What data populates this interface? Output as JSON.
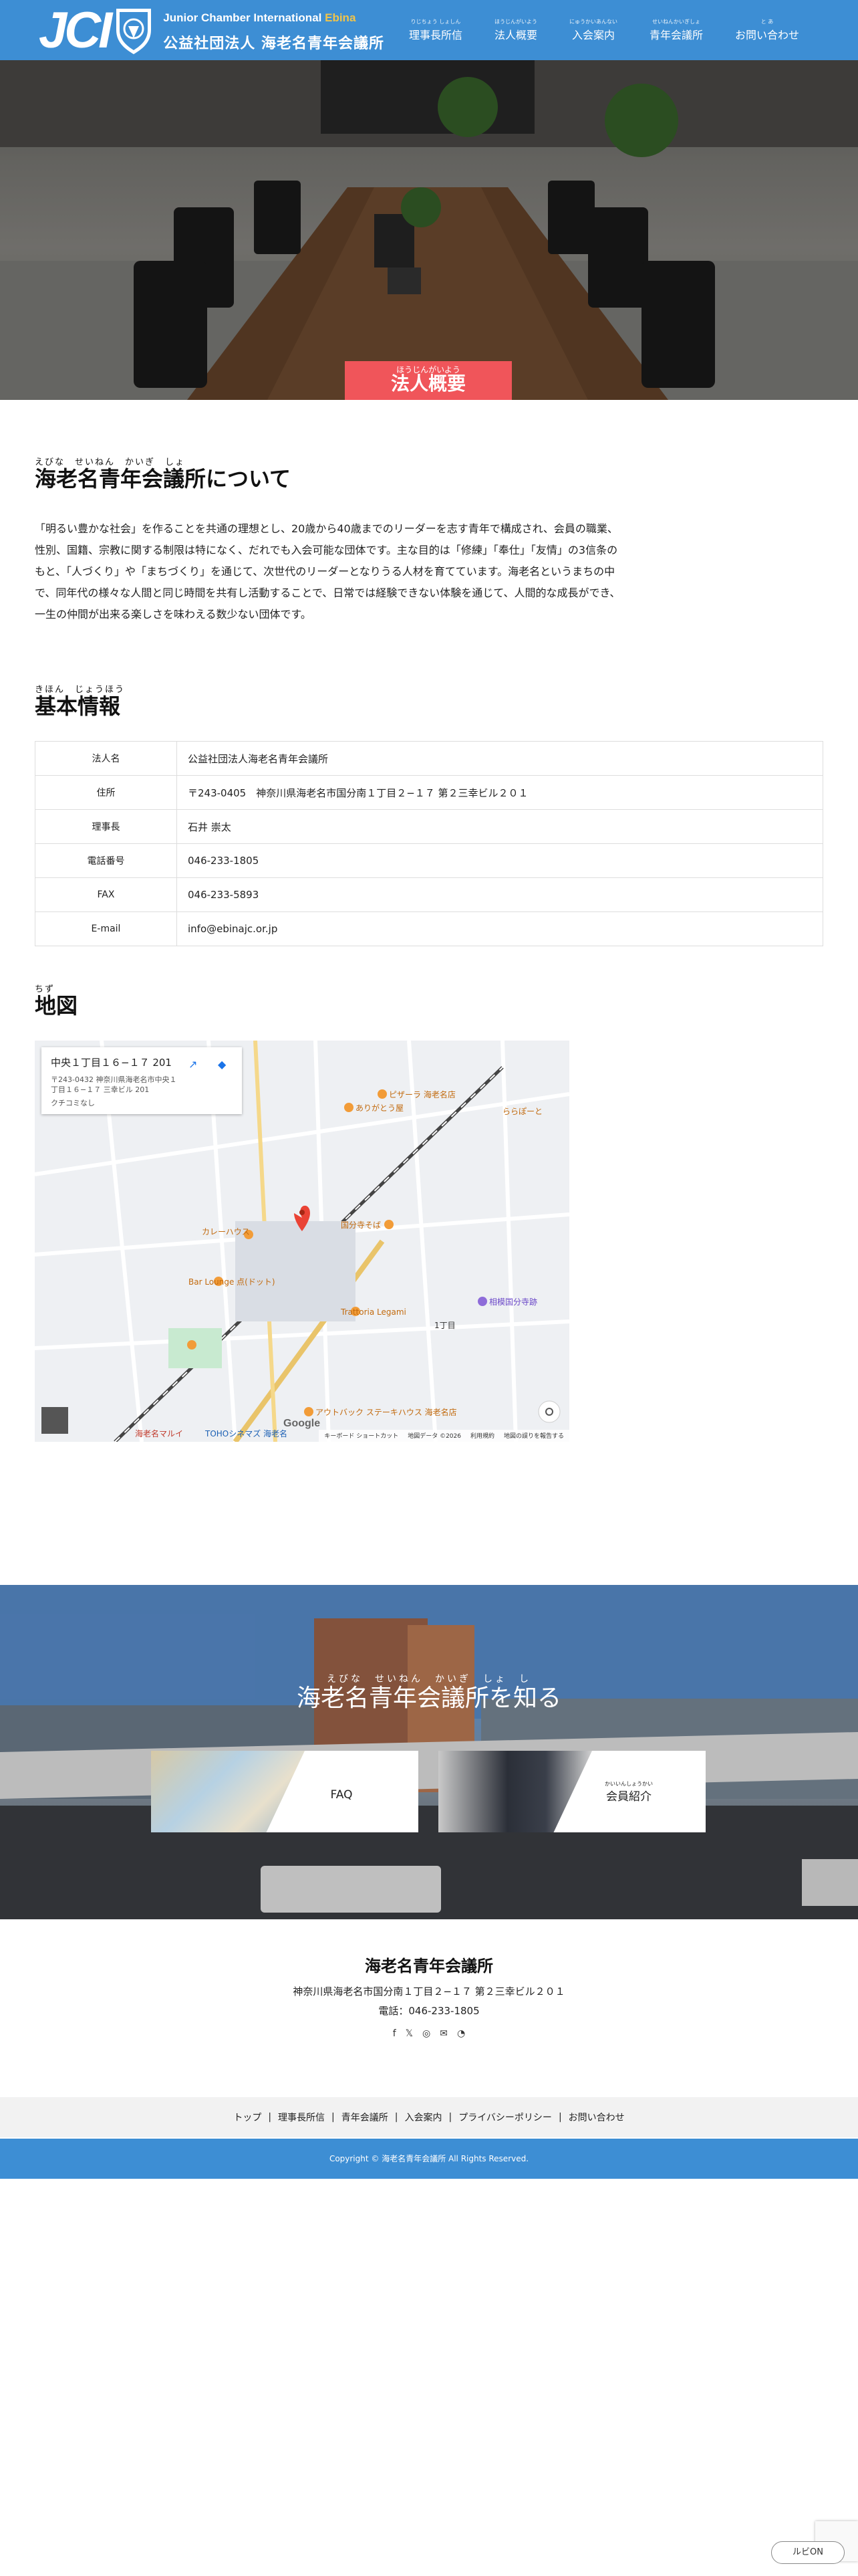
{
  "header": {
    "logo_text": "JCI",
    "org_en_a": "Junior Chamber International",
    "org_en_b": "Ebina",
    "org_jp": "公益社団法人 海老名青年会議所",
    "nav": [
      {
        "ruby": "りじちょう しょしん",
        "label": "理事長所信"
      },
      {
        "ruby": "ほうじんがいよう",
        "label": "法人概要"
      },
      {
        "ruby": "にゅうかいあんない",
        "label": "入会案内"
      },
      {
        "ruby": "せいねんかいぎしょ",
        "label": "青年会議所"
      },
      {
        "ruby": "と あ",
        "label": "お問い合わせ"
      }
    ]
  },
  "hero": {
    "ruby": "ほうじんがいよう",
    "title": "法人概要"
  },
  "about": {
    "heading_ruby": "えびな　せいねん　かいぎ　しょ",
    "heading": "海老名青年会議所について",
    "body": "「明るい豊かな社会」を作ることを共通の理想とし、20歳から40歳までのリーダーを志す青年で構成され、会員の職業、性別、国籍、宗教に関する制限は特になく、だれでも入会可能な団体です。主な目的は「修練」「奉仕」「友情」の3信条のもと、「人づくり」や「まちづくり」を通じて、次世代のリーダーとなりうる人材を育てています。海老名というまちの中で、同年代の様々な人間と同じ時間を共有し活動することで、日常では経験できない体験を通じて、人間的な成長ができ、一生の仲間が出来る楽しさを味わえる数少ない団体です。"
  },
  "basic": {
    "heading_ruby": "きほん　じょうほう",
    "heading": "基本情報",
    "rows": [
      {
        "key": "法人名",
        "value": "公益社団法人海老名青年会議所"
      },
      {
        "key": "住所",
        "value": "〒243-0405　神奈川県海老名市国分南１丁目２−１７ 第２三幸ビル２０１"
      },
      {
        "key": "理事長",
        "value": "石井 崇太"
      },
      {
        "key": "電話番号",
        "value": "046-233-1805"
      },
      {
        "key": "FAX",
        "value": "046-233-5893"
      },
      {
        "key": "E-mail",
        "value": "info@ebinajc.or.jp"
      }
    ]
  },
  "map_section": {
    "heading_ruby": "ちず",
    "heading": "地図",
    "card_title": "中央１丁目１６−１７ 201",
    "card_addr": "〒243-0432 神奈川県海老名市中央１丁目１６−１７ 三幸ビル 201",
    "card_link": "クチコミなし",
    "places": [
      "ありがとう屋",
      "ピザーラ 海老名店",
      "国分寺そば",
      "Bar Lounge 点(ドット)",
      "Trattoria Legami",
      "相模国分寺跡",
      "カレーハウス",
      "アウトバック ステーキハウス 海老名店",
      "ららぽーと",
      "TOHOシネマズ 海老名",
      "海老名マルイ",
      "1丁目"
    ],
    "footer": [
      "キーボード ショートカット",
      "地図データ ©2026",
      "利用規約",
      "地図の誤りを報告する"
    ],
    "google": "Google"
  },
  "know": {
    "heading_ruby": "えびな　せいねん　かいぎ　しょ　し",
    "heading": "海老名青年会議所を知る",
    "cards": [
      {
        "ruby": "",
        "label": "FAQ"
      },
      {
        "ruby": "かいいんしょうかい",
        "label": "会員紹介"
      }
    ]
  },
  "footer": {
    "name": "海老名青年会議所",
    "address": "神奈川県海老名市国分南１丁目２−１７ 第２三幸ビル２０１",
    "tel": "電話：046-233-1805",
    "nav": [
      "トップ",
      "理事長所信",
      "青年会議所",
      "入会案内",
      "プライバシーポリシー",
      "お問い合わせ"
    ],
    "copyright": "Copyright © 海老名青年会議所 All Rights Reserved."
  },
  "ruby_button": "ルビON",
  "colors": {
    "header": "#3d8ed4",
    "accent": "#f0555a",
    "logo_accent": "#f1c44a"
  }
}
